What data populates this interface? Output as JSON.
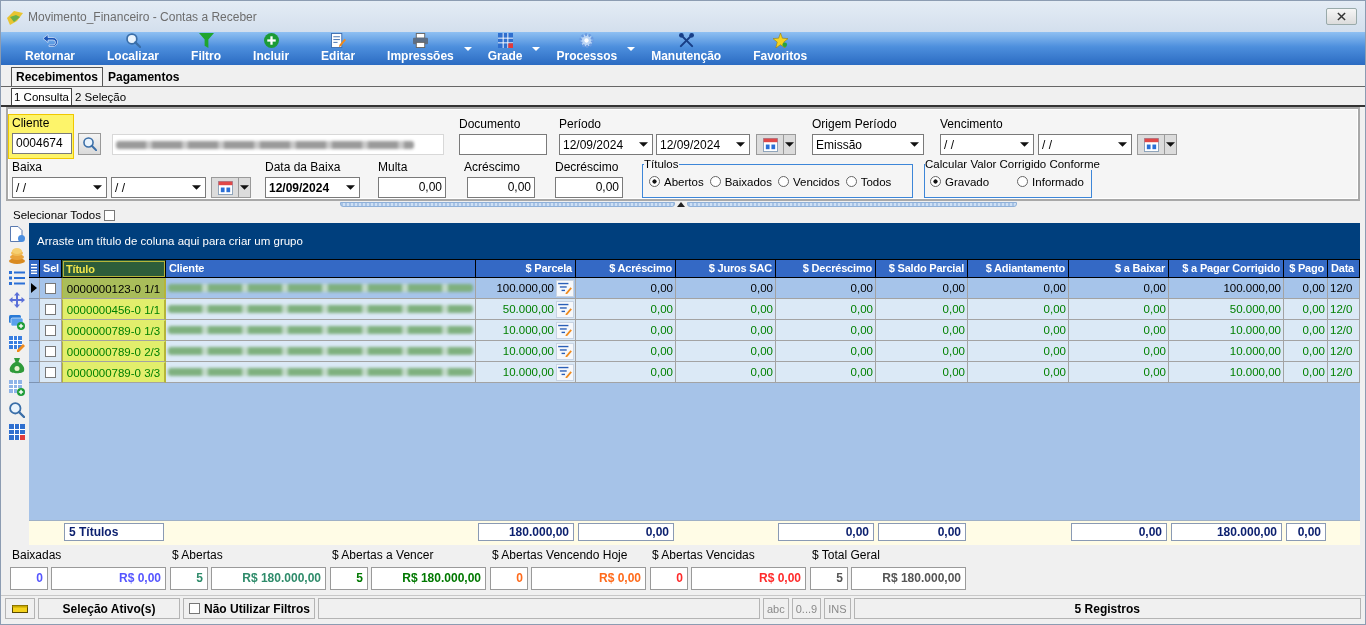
{
  "window": {
    "title": "Movimento_Financeiro - Contas a Receber"
  },
  "toolbar": [
    {
      "label": "Retornar",
      "has_menu": false
    },
    {
      "label": "Localizar",
      "has_menu": false
    },
    {
      "label": "Filtro",
      "has_menu": false
    },
    {
      "label": "Incluir",
      "has_menu": false
    },
    {
      "label": "Editar",
      "has_menu": false
    },
    {
      "label": "Impressões",
      "has_menu": true
    },
    {
      "label": "Grade",
      "has_menu": true
    },
    {
      "label": "Processos",
      "has_menu": true
    },
    {
      "label": "Manutenção",
      "has_menu": false
    },
    {
      "label": "Favoritos",
      "has_menu": false
    }
  ],
  "tabs": [
    {
      "label": "Recebimentos",
      "selected": true
    },
    {
      "label": "Pagamentos",
      "selected": false
    }
  ],
  "subtabs": [
    {
      "label": "1 Consulta",
      "selected": true
    },
    {
      "label": "2 Seleção",
      "selected": false
    }
  ],
  "filters": {
    "cliente": {
      "label": "Cliente",
      "value": "0004674",
      "highlighted": true
    },
    "documento": {
      "label": "Documento"
    },
    "periodo": {
      "label": "Período",
      "from": "12/09/2024",
      "to": "12/09/2024"
    },
    "origem_periodo": {
      "label": "Origem Período",
      "value": "Emissão"
    },
    "vencimento": {
      "label": "Vencimento",
      "from": "/ /",
      "to": "/ /"
    },
    "baixa": {
      "label": "Baixa",
      "from": "/ /",
      "to": "/ /"
    },
    "data_da_baixa": {
      "label": "Data da Baixa",
      "value": "12/09/2024"
    },
    "multa": {
      "label": "Multa",
      "value": "0,00"
    },
    "acrescimo": {
      "label": "Acréscimo",
      "value": "0,00"
    },
    "decrescimo": {
      "label": "Decréscimo",
      "value": "0,00"
    },
    "titulos": {
      "label": "Títulos",
      "options": [
        {
          "label": "Abertos",
          "selected": true
        },
        {
          "label": "Baixados",
          "selected": false
        },
        {
          "label": "Vencidos",
          "selected": false
        },
        {
          "label": "Todos",
          "selected": false
        }
      ]
    },
    "calcular": {
      "label": "Calcular Valor Corrigido Conforme",
      "options": [
        {
          "label": "Gravado",
          "selected": true
        },
        {
          "label": "Informado",
          "selected": false
        }
      ]
    }
  },
  "select_all": {
    "label": "Selecionar Todos",
    "checked": false
  },
  "grid": {
    "group_hint": "Arraste um título de coluna aqui para criar um grupo",
    "columns": [
      {
        "label": "Sel",
        "kind": "check",
        "highlighted": false
      },
      {
        "label": "Título",
        "kind": "text",
        "highlighted": true,
        "total": "5 Títulos"
      },
      {
        "label": "Cliente",
        "kind": "name",
        "highlighted": false
      },
      {
        "label": "$ Parcela",
        "kind": "editable",
        "highlighted": false,
        "total": "180.000,00"
      },
      {
        "label": "$ Acréscimo",
        "kind": "money",
        "highlighted": false,
        "total": "0,00"
      },
      {
        "label": "$ Juros SAC",
        "kind": "money",
        "highlighted": false
      },
      {
        "label": "$ Decréscimo",
        "kind": "money",
        "highlighted": false,
        "total": "0,00"
      },
      {
        "label": "$ Saldo Parcial",
        "kind": "money",
        "highlighted": false,
        "total": "0,00"
      },
      {
        "label": "$ Adiantamento",
        "kind": "money",
        "highlighted": false
      },
      {
        "label": "$ a Baixar",
        "kind": "money",
        "highlighted": false,
        "total": "0,00"
      },
      {
        "label": "$ a Pagar Corrigido",
        "kind": "money",
        "highlighted": false,
        "total": "180.000,00"
      },
      {
        "label": "$ Pago",
        "kind": "money",
        "highlighted": false,
        "total": "0,00"
      },
      {
        "label": "Data",
        "kind": "date",
        "highlighted": false
      }
    ],
    "rows": [
      {
        "selected": true,
        "checked": false,
        "titulo": "0000000123-0 1/1",
        "values": [
          "100.000,00",
          "0,00",
          "0,00",
          "0,00",
          "0,00",
          "0,00",
          "0,00",
          "100.000,00",
          "0,00",
          "12/0"
        ]
      },
      {
        "selected": false,
        "checked": false,
        "titulo": "0000000456-0 1/1",
        "values": [
          "50.000,00",
          "0,00",
          "0,00",
          "0,00",
          "0,00",
          "0,00",
          "0,00",
          "50.000,00",
          "0,00",
          "12/0"
        ]
      },
      {
        "selected": false,
        "checked": false,
        "titulo": "0000000789-0 1/3",
        "values": [
          "10.000,00",
          "0,00",
          "0,00",
          "0,00",
          "0,00",
          "0,00",
          "0,00",
          "10.000,00",
          "0,00",
          "12/0"
        ]
      },
      {
        "selected": false,
        "checked": false,
        "titulo": "0000000789-0 2/3",
        "values": [
          "10.000,00",
          "0,00",
          "0,00",
          "0,00",
          "0,00",
          "0,00",
          "0,00",
          "10.000,00",
          "0,00",
          "12/0"
        ]
      },
      {
        "selected": false,
        "checked": false,
        "titulo": "0000000789-0 3/3",
        "values": [
          "10.000,00",
          "0,00",
          "0,00",
          "0,00",
          "0,00",
          "0,00",
          "0,00",
          "10.000,00",
          "0,00",
          "12/0"
        ]
      }
    ]
  },
  "summary": [
    {
      "label": "Baixadas",
      "count": "0",
      "amount": "R$ 0,00",
      "color": "#5555ff"
    },
    {
      "label": "$ Abertas",
      "count": "5",
      "amount": "R$ 180.000,00",
      "color": "#2e8b6a"
    },
    {
      "label": "$ Abertas a Vencer",
      "count": "5",
      "amount": "R$ 180.000,00",
      "color": "#007800"
    },
    {
      "label": "$ Abertas Vencendo Hoje",
      "count": "0",
      "amount": "R$ 0,00",
      "color": "#ff6a1a"
    },
    {
      "label": "$ Abertas Vencidas",
      "count": "0",
      "amount": "R$ 0,00",
      "color": "#ff2a2a"
    },
    {
      "label": "$ Total Geral",
      "count": "5",
      "amount": "R$ 180.000,00",
      "color": "#555555"
    }
  ],
  "status_bar": {
    "selection": "Seleção Ativo(s)",
    "no_filters": {
      "label": "Não Utilizar Filtros",
      "checked": false
    },
    "indicators": [
      {
        "label": "abc",
        "on": false
      },
      {
        "label": "0...9",
        "on": false
      },
      {
        "label": "INS",
        "on": false
      }
    ],
    "records": "5 Registros"
  }
}
